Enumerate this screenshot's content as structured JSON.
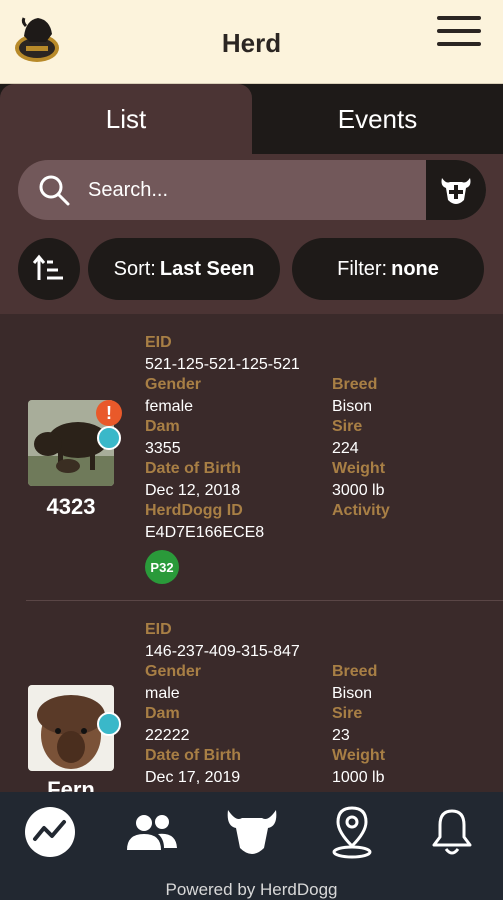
{
  "header": {
    "title": "Herd"
  },
  "tabs": [
    {
      "label": "List",
      "active": true
    },
    {
      "label": "Events",
      "active": false
    }
  ],
  "search": {
    "placeholder": "Search..."
  },
  "sort": {
    "prefix": "Sort:",
    "value": "Last Seen"
  },
  "filter": {
    "prefix": "Filter:",
    "value": "none"
  },
  "colors": {
    "accent": "#a87f45",
    "header_bg": "#fcf3dc",
    "alert": "#e9592a",
    "status_dot": "#3ab8c9",
    "badge_green": "#2a9a3a"
  },
  "animals": [
    {
      "tag": "4323",
      "labels": {
        "eid": "EID",
        "gender": "Gender",
        "breed": "Breed",
        "dam": "Dam",
        "sire": "Sire",
        "dob": "Date of Birth",
        "weight": "Weight",
        "herddogg_id": "HerdDogg ID",
        "activity": "Activity"
      },
      "eid": "521-125-521-125-521",
      "gender": "female",
      "breed": "Bison",
      "dam": "3355",
      "sire": "224",
      "dob": "Dec 12, 2018",
      "weight": "3000 lb",
      "herddogg_id": "E4D7E166ECE8",
      "badge": "P32",
      "alert": "!"
    },
    {
      "tag": "Fern",
      "labels": {
        "eid": "EID",
        "gender": "Gender",
        "breed": "Breed",
        "dam": "Dam",
        "sire": "Sire",
        "dob": "Date of Birth",
        "weight": "Weight"
      },
      "eid": "146-237-409-315-847",
      "gender": "male",
      "breed": "Bison",
      "dam": "22222",
      "sire": "23",
      "dob": "Dec 17, 2019",
      "weight": "1000 lb"
    }
  ],
  "bottom_nav": [
    {
      "icon": "activity-chart-icon"
    },
    {
      "icon": "users-icon"
    },
    {
      "icon": "bison-head-icon"
    },
    {
      "icon": "map-pin-icon"
    },
    {
      "icon": "bell-icon"
    }
  ],
  "footer": {
    "powered_by": "Powered by HerdDogg"
  }
}
